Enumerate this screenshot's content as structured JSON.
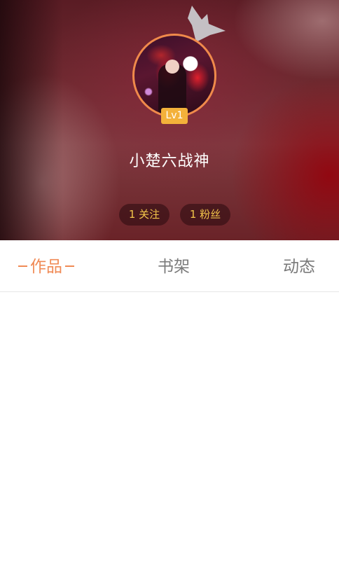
{
  "profile": {
    "level": "Lv1",
    "nickname": "小楚六战神",
    "follow_count_label": "1 关注",
    "fans_count_label": "1 粉丝"
  },
  "tabs": [
    {
      "label": "作品",
      "active": true
    },
    {
      "label": "书架",
      "active": false
    },
    {
      "label": "动态",
      "active": false
    }
  ],
  "colors": {
    "accent": "#f08a55",
    "level_badge": "#f3b13a",
    "stat_text": "#f3c64a",
    "avatar_ring": "#f08a4b"
  },
  "icons": [
    "crown-icon"
  ]
}
